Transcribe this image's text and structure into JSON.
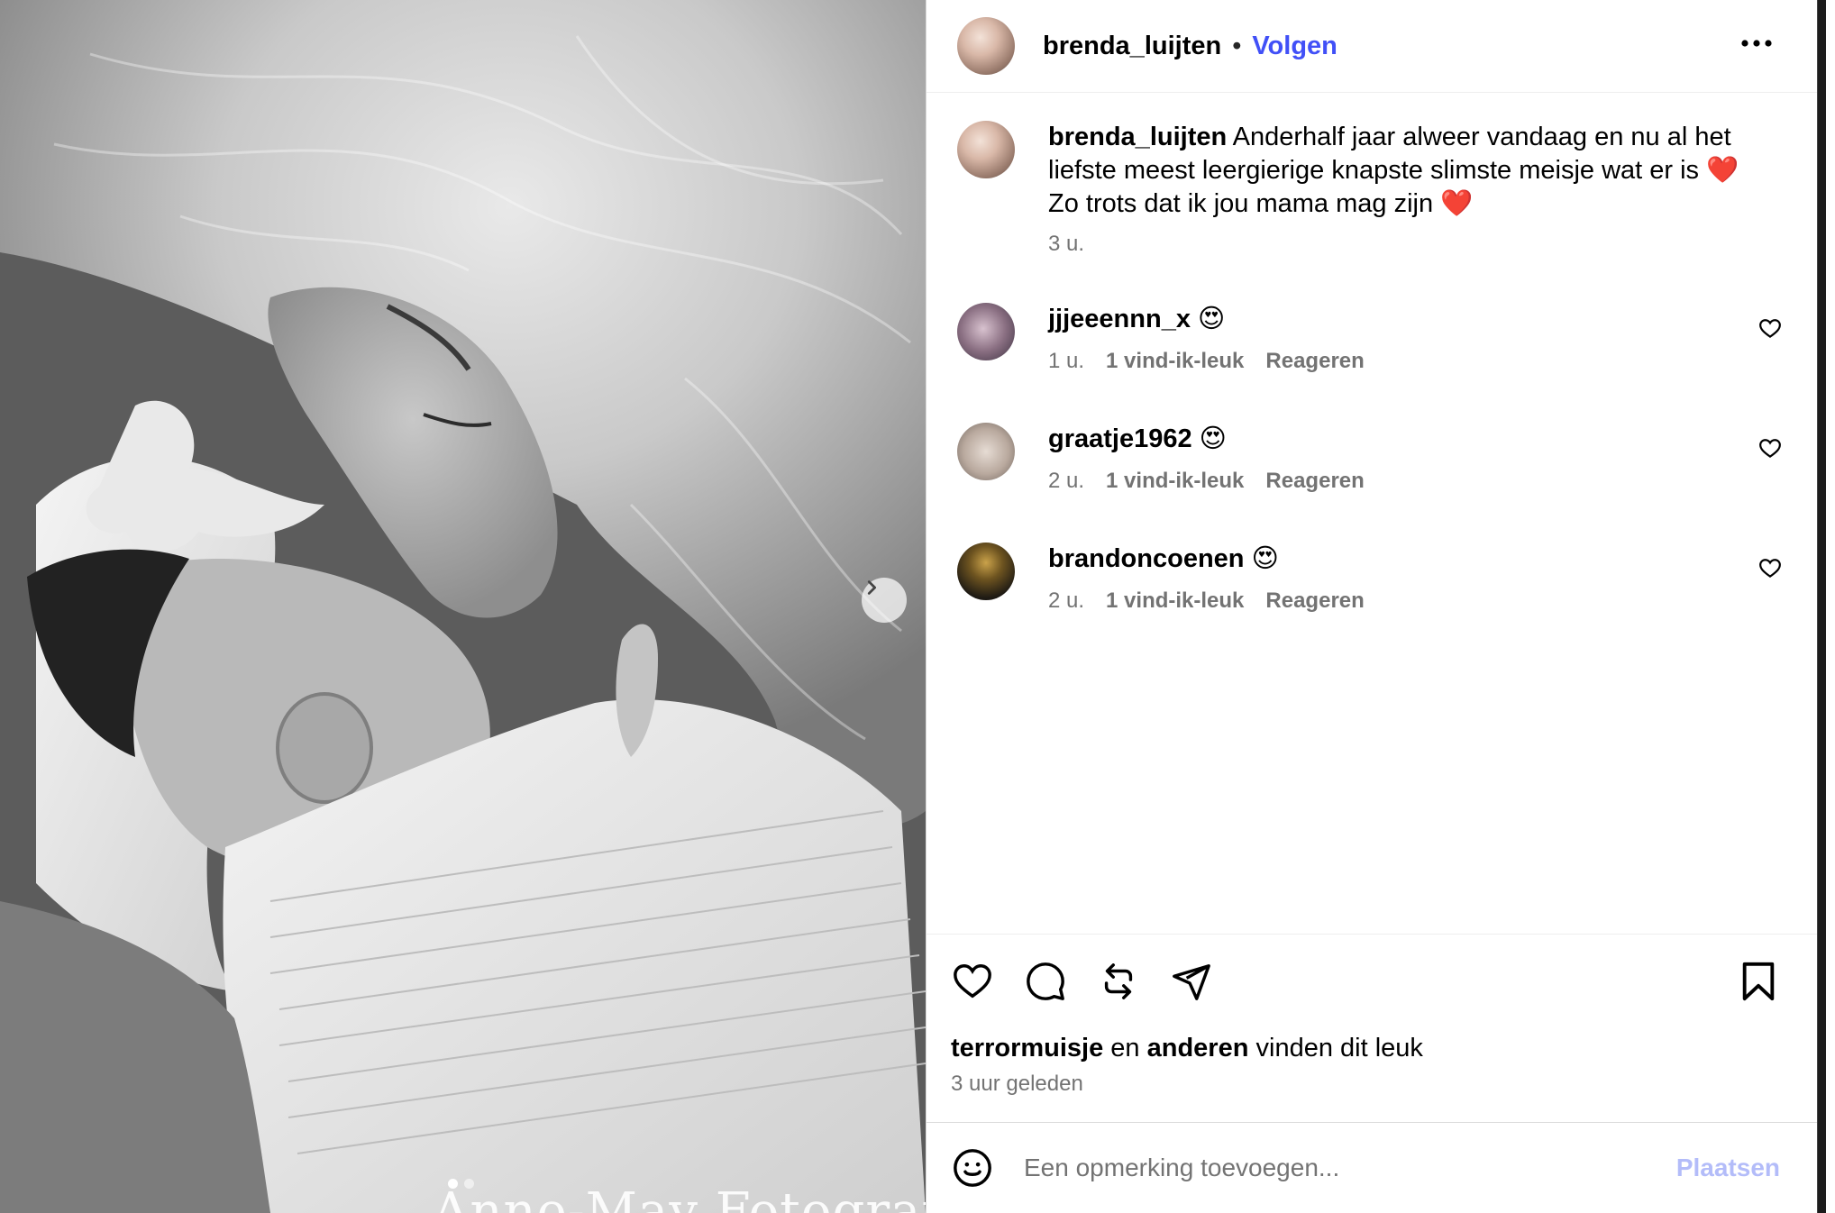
{
  "post": {
    "author": "brenda_luijten",
    "separator": "•",
    "follow_label": "Volgen",
    "more_icon": "more-horizontal-icon",
    "caption": {
      "author": "brenda_luijten",
      "text": " Anderhalf jaar alweer vandaag en nu al het liefste meest leergierige knapste slimste meisje wat er is ",
      "emoji1": "❤️",
      "text2": " Zo trots dat ik jou mama mag zijn ",
      "emoji2": "❤️",
      "time": "3 u."
    }
  },
  "photo": {
    "watermark": "Anne-May Fotografie",
    "next_icon": "chevron-right-icon",
    "carousel_count": 2,
    "carousel_active": 1
  },
  "comments": [
    {
      "username": "jjjeeennn_x",
      "text": " 😍",
      "time": "1 u.",
      "likes": "1 vind-ik-leuk",
      "reply": "Reageren"
    },
    {
      "username": "graatje1962",
      "text": " 😍",
      "time": "2 u.",
      "likes": "1 vind-ik-leuk",
      "reply": "Reageren"
    },
    {
      "username": "brandoncoenen",
      "text": " 😍",
      "time": "2 u.",
      "likes": "1 vind-ik-leuk",
      "reply": "Reageren"
    }
  ],
  "actions": {
    "like_icon": "heart-icon",
    "comment_icon": "comment-icon",
    "repost_icon": "repost-icon",
    "share_icon": "send-icon",
    "save_icon": "bookmark-icon"
  },
  "likes": {
    "first_user": "terrormuisje",
    "connector": " en ",
    "others": "anderen",
    "suffix": " vinden dit leuk"
  },
  "posted_time": "3 uur geleden",
  "comment_form": {
    "emoji_icon": "smiley-icon",
    "placeholder": "Een opmerking toevoegen...",
    "post_label": "Plaatsen"
  }
}
